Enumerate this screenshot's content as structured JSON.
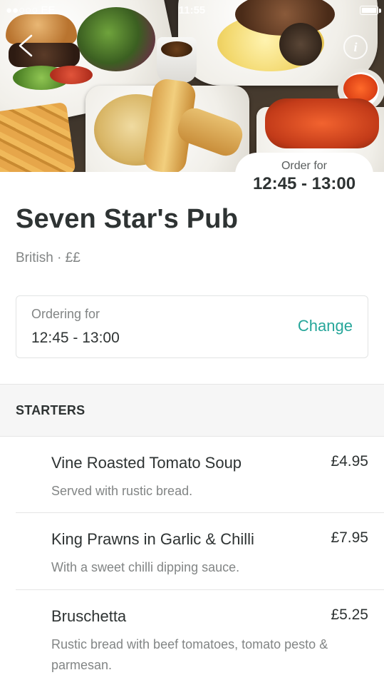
{
  "status_bar": {
    "carrier": "●●○○○ EE",
    "time": "11:55"
  },
  "hero": {
    "order_for_label": "Order for",
    "order_for_time": "12:45 - 13:00"
  },
  "restaurant": {
    "name": "Seven Star's Pub",
    "meta": "British · ££"
  },
  "ordering": {
    "label": "Ordering for",
    "time": "12:45 - 13:00",
    "change_label": "Change"
  },
  "menu": {
    "section_title": "STARTERS",
    "items": [
      {
        "name": "Vine Roasted Tomato Soup",
        "price": "£4.95",
        "description": "Served with rustic bread."
      },
      {
        "name": "King Prawns in Garlic & Chilli",
        "price": "£7.95",
        "description": "With a sweet chilli dipping sauce."
      },
      {
        "name": "Bruschetta",
        "price": "£5.25",
        "description": "Rustic bread with beef tomatoes, tomato pesto & parmesan."
      }
    ]
  },
  "colors": {
    "accent": "#26a69a",
    "text_primary": "#2e3333",
    "text_secondary": "#828585",
    "section_bg": "#f6f6f6"
  },
  "icons": {
    "back": "back-arrow-icon",
    "info": "info-icon",
    "battery": "battery-icon"
  }
}
